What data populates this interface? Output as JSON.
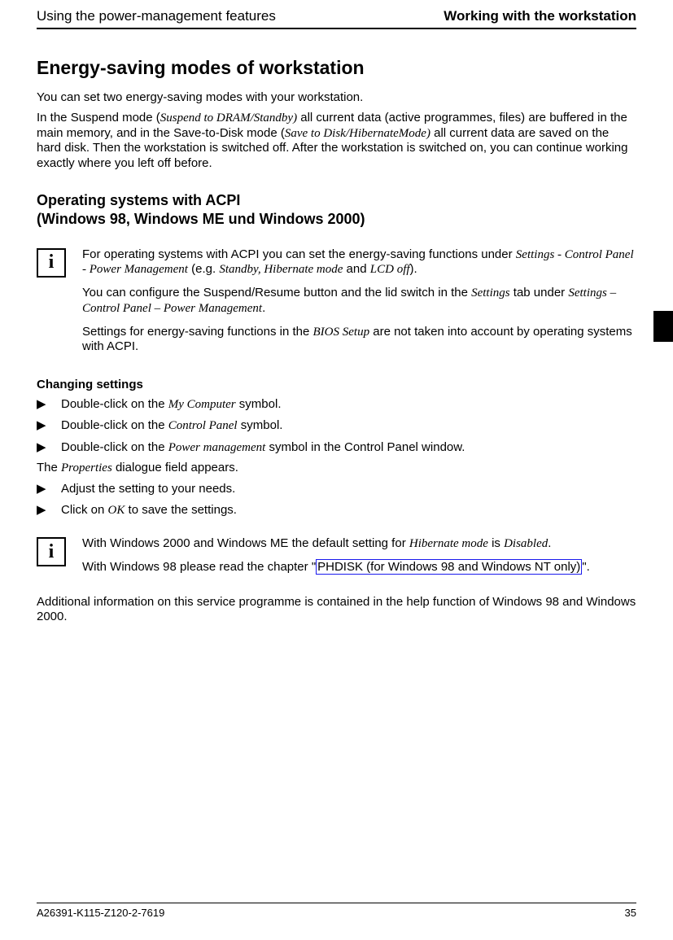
{
  "header": {
    "left": "Using the power-management features",
    "right": "Working with the workstation"
  },
  "h1": "Energy-saving modes of workstation",
  "intro1": "You can set two energy-saving modes with your workstation.",
  "intro2_a": "In the Suspend mode (",
  "intro2_i1": "Suspend to DRAM/Standby)",
  "intro2_b": " all current data (active programmes, files) are buffered in the main memory, and in the Save-to-Disk mode (",
  "intro2_i2": "Save to Disk/HibernateMode)",
  "intro2_c": " all current data are saved on the hard disk. Then the workstation is switched off. After the workstation is switched on, you can continue working exactly where you left off before.",
  "h2a": "Operating systems with ACPI",
  "h2b": "(Windows 98, Windows ME und Windows 2000)",
  "info1": {
    "p1a": "For operating systems with ACPI you can set the energy-saving functions under ",
    "p1i1": "Settings - Control Panel - Power Management",
    "p1b": " (e.g. ",
    "p1i2": "Standby, Hibernate mode",
    "p1c": " and ",
    "p1i3": "LCD off",
    "p1d": ").",
    "p2a": "You can configure the Suspend/Resume button and the lid switch in the ",
    "p2i1": "Settings",
    "p2b": " tab under ",
    "p2i2": "Settings – Control Panel – Power Management",
    "p2c": ".",
    "p3a": "Settings for energy-saving functions in the ",
    "p3i1": "BIOS Setup",
    "p3b": " are not taken into account by operating systems with ACPI."
  },
  "changing": "Changing settings",
  "steps": {
    "s1a": "Double-click on the ",
    "s1i": "My Computer",
    "s1b": " symbol.",
    "s2a": "Double-click on the ",
    "s2i": "Control Panel",
    "s2b": " symbol.",
    "s3a": "Double-click on the ",
    "s3i": "Power management",
    "s3b": " symbol in the Control Panel window."
  },
  "mid1a": "The ",
  "mid1i": "Properties",
  "mid1b": " dialogue field appears.",
  "steps2": {
    "s4": "Adjust the setting to your needs.",
    "s5a": "Click on ",
    "s5i": "OK",
    "s5b": " to save the settings."
  },
  "info2": {
    "p1a": "With Windows 2000 and Windows ME the default setting for ",
    "p1i1": "Hibernate mode",
    "p1b": " is ",
    "p1i2": "Disabled",
    "p1c": ".",
    "p2a": "With Windows 98 please read the chapter \"",
    "p2link": "PHDISK (for Windows 98 and Windows NT only)",
    "p2b": "\"."
  },
  "closing": "Additional information on this service programme is contained in the help function of Windows 98 and Windows 2000.",
  "footer": {
    "left": "A26391-K115-Z120-2-7619",
    "right": "35"
  },
  "icon_label": "i"
}
